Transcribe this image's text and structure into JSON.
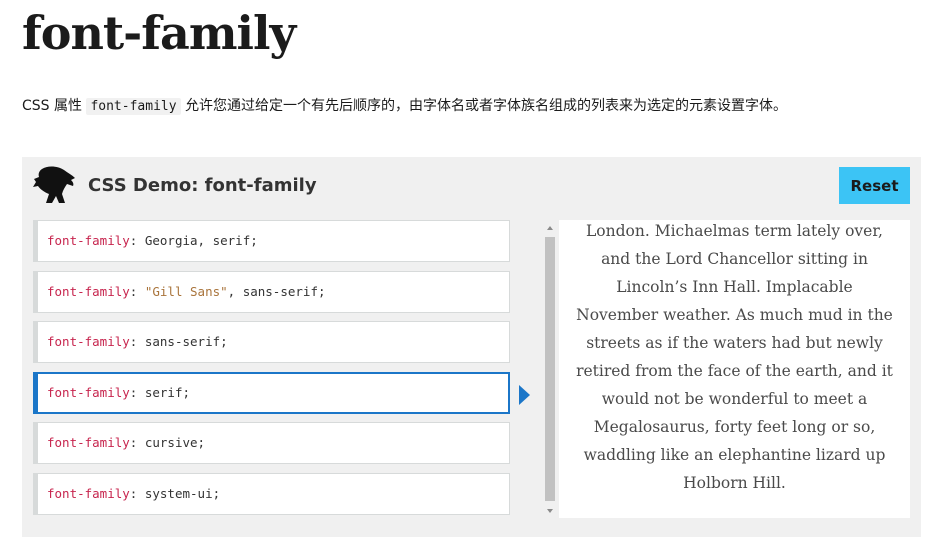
{
  "page": {
    "title": "font-family",
    "intro_before": "CSS 属性 ",
    "intro_code": "font-family",
    "intro_after": " 允许您通过给定一个有先后顺序的，由字体名或者字体族名组成的列表来为选定的元素设置字体。"
  },
  "demo": {
    "title": "CSS Demo: font-family",
    "logo_icon": "dinosaur-logo-icon",
    "reset_label": "Reset",
    "accent_color": "#1b76c8",
    "reset_color": "#3cc4f5",
    "choices": [
      {
        "prop": "font-family",
        "colon": ": ",
        "value": "Georgia, serif",
        "end": ";"
      },
      {
        "prop": "font-family",
        "colon": ": ",
        "str": "\"Gill Sans\"",
        "value": ", sans-serif",
        "end": ";"
      },
      {
        "prop": "font-family",
        "colon": ": ",
        "value": "sans-serif",
        "end": ";"
      },
      {
        "prop": "font-family",
        "colon": ": ",
        "value": "serif",
        "end": ";"
      },
      {
        "prop": "font-family",
        "colon": ": ",
        "value": "cursive",
        "end": ";"
      },
      {
        "prop": "font-family",
        "colon": ": ",
        "value": "system-ui",
        "end": ";"
      }
    ],
    "selected_index": 3,
    "output_text": "London. Michaelmas term lately over, and the Lord Chancellor sitting in Lincoln’s Inn Hall. Implacable November weather. As much mud in the streets as if the waters had but newly retired from the face of the earth, and it would not be wonderful to meet a Megalosaurus, forty feet long or so, waddling like an elephantine lizard up Holborn Hill."
  }
}
